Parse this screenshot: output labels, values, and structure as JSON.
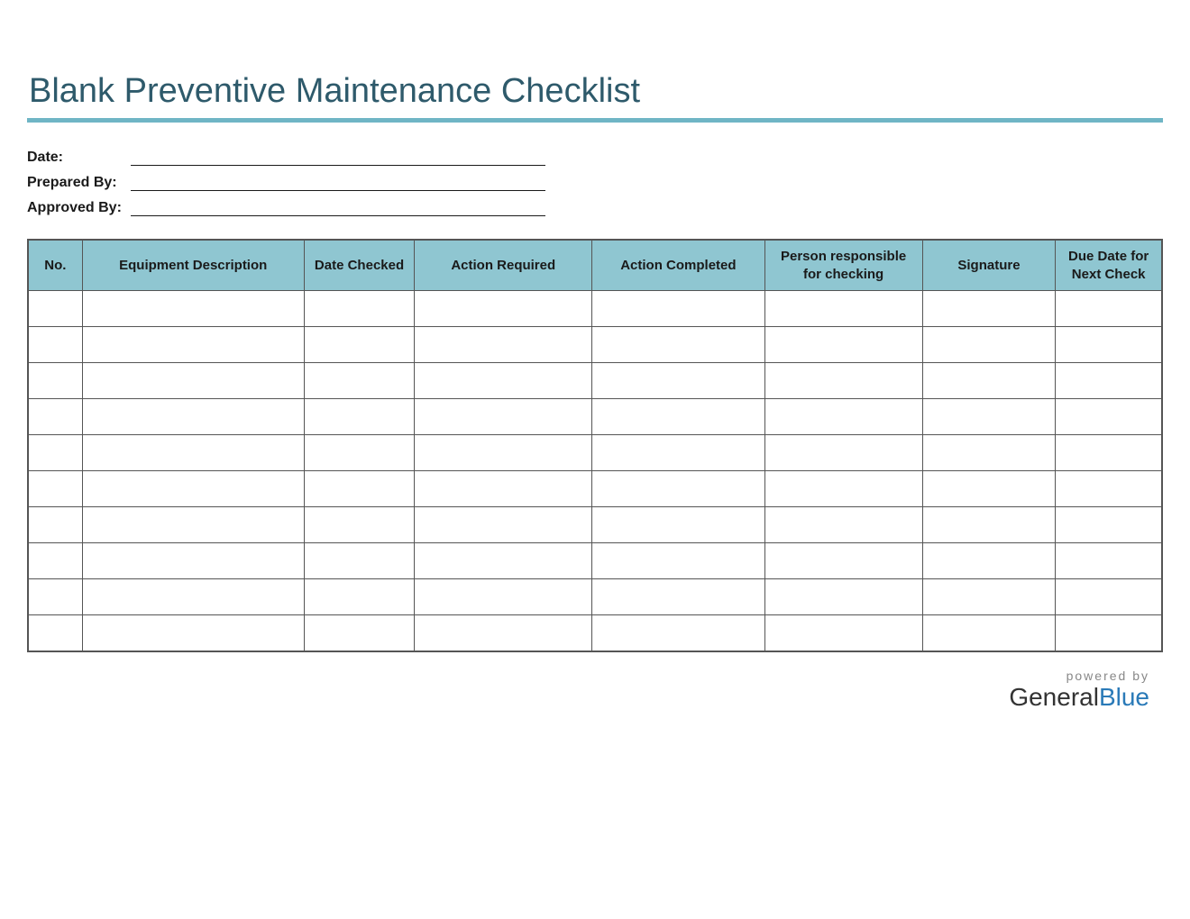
{
  "title": "Blank Preventive Maintenance Checklist",
  "meta": {
    "date_label": "Date:",
    "prepared_by_label": "Prepared By:",
    "approved_by_label": "Approved By:",
    "date_value": "",
    "prepared_by_value": "",
    "approved_by_value": ""
  },
  "table": {
    "headers": {
      "no": "No.",
      "equipment_description": "Equipment Description",
      "date_checked": "Date Checked",
      "action_required": "Action Required",
      "action_completed": "Action Completed",
      "person_responsible": "Person responsible for checking",
      "signature": "Signature",
      "due_date": "Due Date for Next Check"
    },
    "rows": [
      {
        "no": "",
        "equipment_description": "",
        "date_checked": "",
        "action_required": "",
        "action_completed": "",
        "person_responsible": "",
        "signature": "",
        "due_date": ""
      },
      {
        "no": "",
        "equipment_description": "",
        "date_checked": "",
        "action_required": "",
        "action_completed": "",
        "person_responsible": "",
        "signature": "",
        "due_date": ""
      },
      {
        "no": "",
        "equipment_description": "",
        "date_checked": "",
        "action_required": "",
        "action_completed": "",
        "person_responsible": "",
        "signature": "",
        "due_date": ""
      },
      {
        "no": "",
        "equipment_description": "",
        "date_checked": "",
        "action_required": "",
        "action_completed": "",
        "person_responsible": "",
        "signature": "",
        "due_date": ""
      },
      {
        "no": "",
        "equipment_description": "",
        "date_checked": "",
        "action_required": "",
        "action_completed": "",
        "person_responsible": "",
        "signature": "",
        "due_date": ""
      },
      {
        "no": "",
        "equipment_description": "",
        "date_checked": "",
        "action_required": "",
        "action_completed": "",
        "person_responsible": "",
        "signature": "",
        "due_date": ""
      },
      {
        "no": "",
        "equipment_description": "",
        "date_checked": "",
        "action_required": "",
        "action_completed": "",
        "person_responsible": "",
        "signature": "",
        "due_date": ""
      },
      {
        "no": "",
        "equipment_description": "",
        "date_checked": "",
        "action_required": "",
        "action_completed": "",
        "person_responsible": "",
        "signature": "",
        "due_date": ""
      },
      {
        "no": "",
        "equipment_description": "",
        "date_checked": "",
        "action_required": "",
        "action_completed": "",
        "person_responsible": "",
        "signature": "",
        "due_date": ""
      },
      {
        "no": "",
        "equipment_description": "",
        "date_checked": "",
        "action_required": "",
        "action_completed": "",
        "person_responsible": "",
        "signature": "",
        "due_date": ""
      }
    ]
  },
  "footer": {
    "powered_by": "powered by",
    "brand_general": "General",
    "brand_blue": "Blue"
  }
}
